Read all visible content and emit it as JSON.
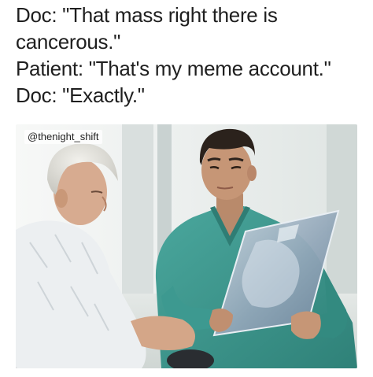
{
  "caption": {
    "lines": [
      "Doc: \"That mass right there is",
      "cancerous.\"",
      "Patient: \"That's my meme account.\"",
      "Doc: \"Exactly.\""
    ]
  },
  "photo": {
    "watermark": "@thenight_shift"
  },
  "colors": {
    "text": "#1f1f1f",
    "scrubs": "#3f9a90",
    "gown": "#eef1f2",
    "xray_film": "#9fb1c2",
    "background_wall": "#eef1f0"
  },
  "icons": []
}
